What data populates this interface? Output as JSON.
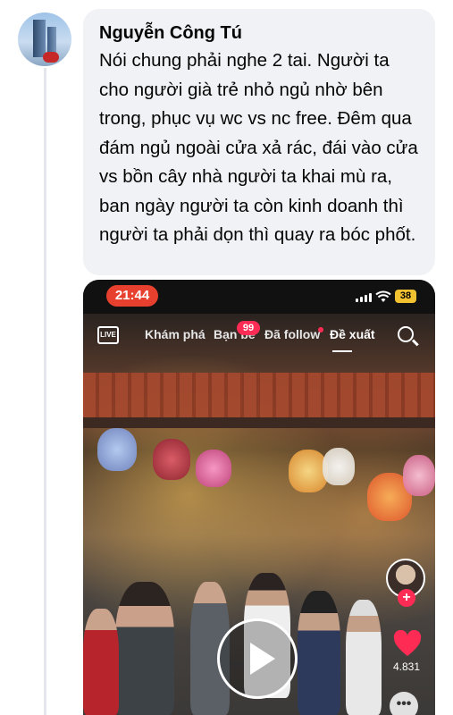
{
  "comment": {
    "author": "Nguyễn Công Tú",
    "text": "Nói chung phải nghe 2 tai. Người ta cho người già trẻ nhỏ ngủ nhờ bên trong, phục vụ wc vs nc free. Đêm qua đám ngủ ngoài cửa xả rác, đái vào cửa vs bồn cây nhà người ta khai mù ra, ban ngày người ta còn kinh doanh thì người ta phải dọn thì quay ra bóc phốt."
  },
  "attachment": {
    "status_bar": {
      "time": "21:44",
      "battery": "38"
    },
    "nav": {
      "live_label": "LIVE",
      "tabs": [
        "Khám phá",
        "Bạn bè",
        "Đã follow",
        "Đề xuất"
      ],
      "friends_badge": "99",
      "active_tab": "Đề xuất"
    },
    "video": {
      "likes": "4.831",
      "more": "•••"
    },
    "icons": [
      "live-icon",
      "search-icon",
      "follow-plus-icon",
      "heart-icon",
      "play-icon",
      "more-icon"
    ],
    "colors": {
      "accent": "#fe2c55",
      "time_pill": "#e8402f",
      "battery": "#f2c230"
    }
  }
}
